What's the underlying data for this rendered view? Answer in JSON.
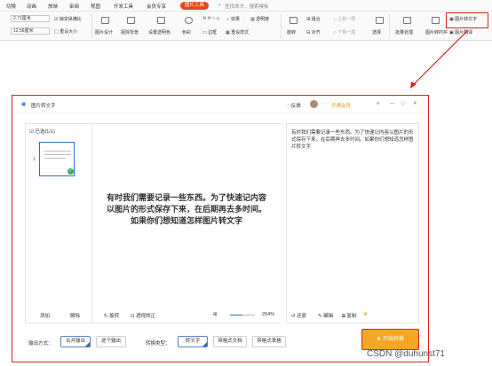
{
  "menubar": {
    "items": [
      "切换",
      "动画",
      "放映",
      "审阅",
      "视图",
      "开发工具",
      "会员专享"
    ],
    "active": "图片工具",
    "search": "查找命令、搜索模板"
  },
  "ribbon": {
    "width_value": "2.71厘米",
    "height_value": "12.56厘米",
    "lock_ratio": "锁定纵横比",
    "reset_size": "重设大小",
    "buttons": [
      "图片设计",
      "抠除背景",
      "设置透明色",
      "色彩",
      "边框",
      "重设样式",
      "效果",
      "透明度",
      "组合",
      "对齐",
      "上移一层",
      "下移一层",
      "旋转",
      "选择",
      "批量处理",
      "图片转PDF",
      "图片转文字",
      "图片翻译"
    ],
    "highlight_top": "图片转文字",
    "highlight_bottom": "图片翻译"
  },
  "dialog": {
    "title": "图片转文字",
    "feedback": "反馈",
    "vip": "开通会员",
    "selected": "已选(1/1)",
    "page_num": "1",
    "add": "添加",
    "delete": "删除",
    "rotate": "旋转",
    "perspective": "透视矫正",
    "zoom": "204%",
    "preview_text": "有时我们需要记录一些东西。为了快速记内容以图片的形式保存下来，在后期再去多时间。如果你们想知道怎样图片转文字",
    "result_text": "有时我们需要记录一些东西。为了快速记内容以图片的形式保存下来，在后期再去多时间。如果你们想知道怎样图片转文字",
    "restore": "还原",
    "edit": "编辑",
    "copy": "复制",
    "output_label": "输出方式：",
    "output_merge": "合并输出",
    "output_single": "逐个输出",
    "convert_label": "转换类型：",
    "type_text": "转文字",
    "type_doc": "带格式文档",
    "type_table": "带格式表格",
    "start": "开始转换"
  },
  "watermark": "CSDN @duhunst71"
}
